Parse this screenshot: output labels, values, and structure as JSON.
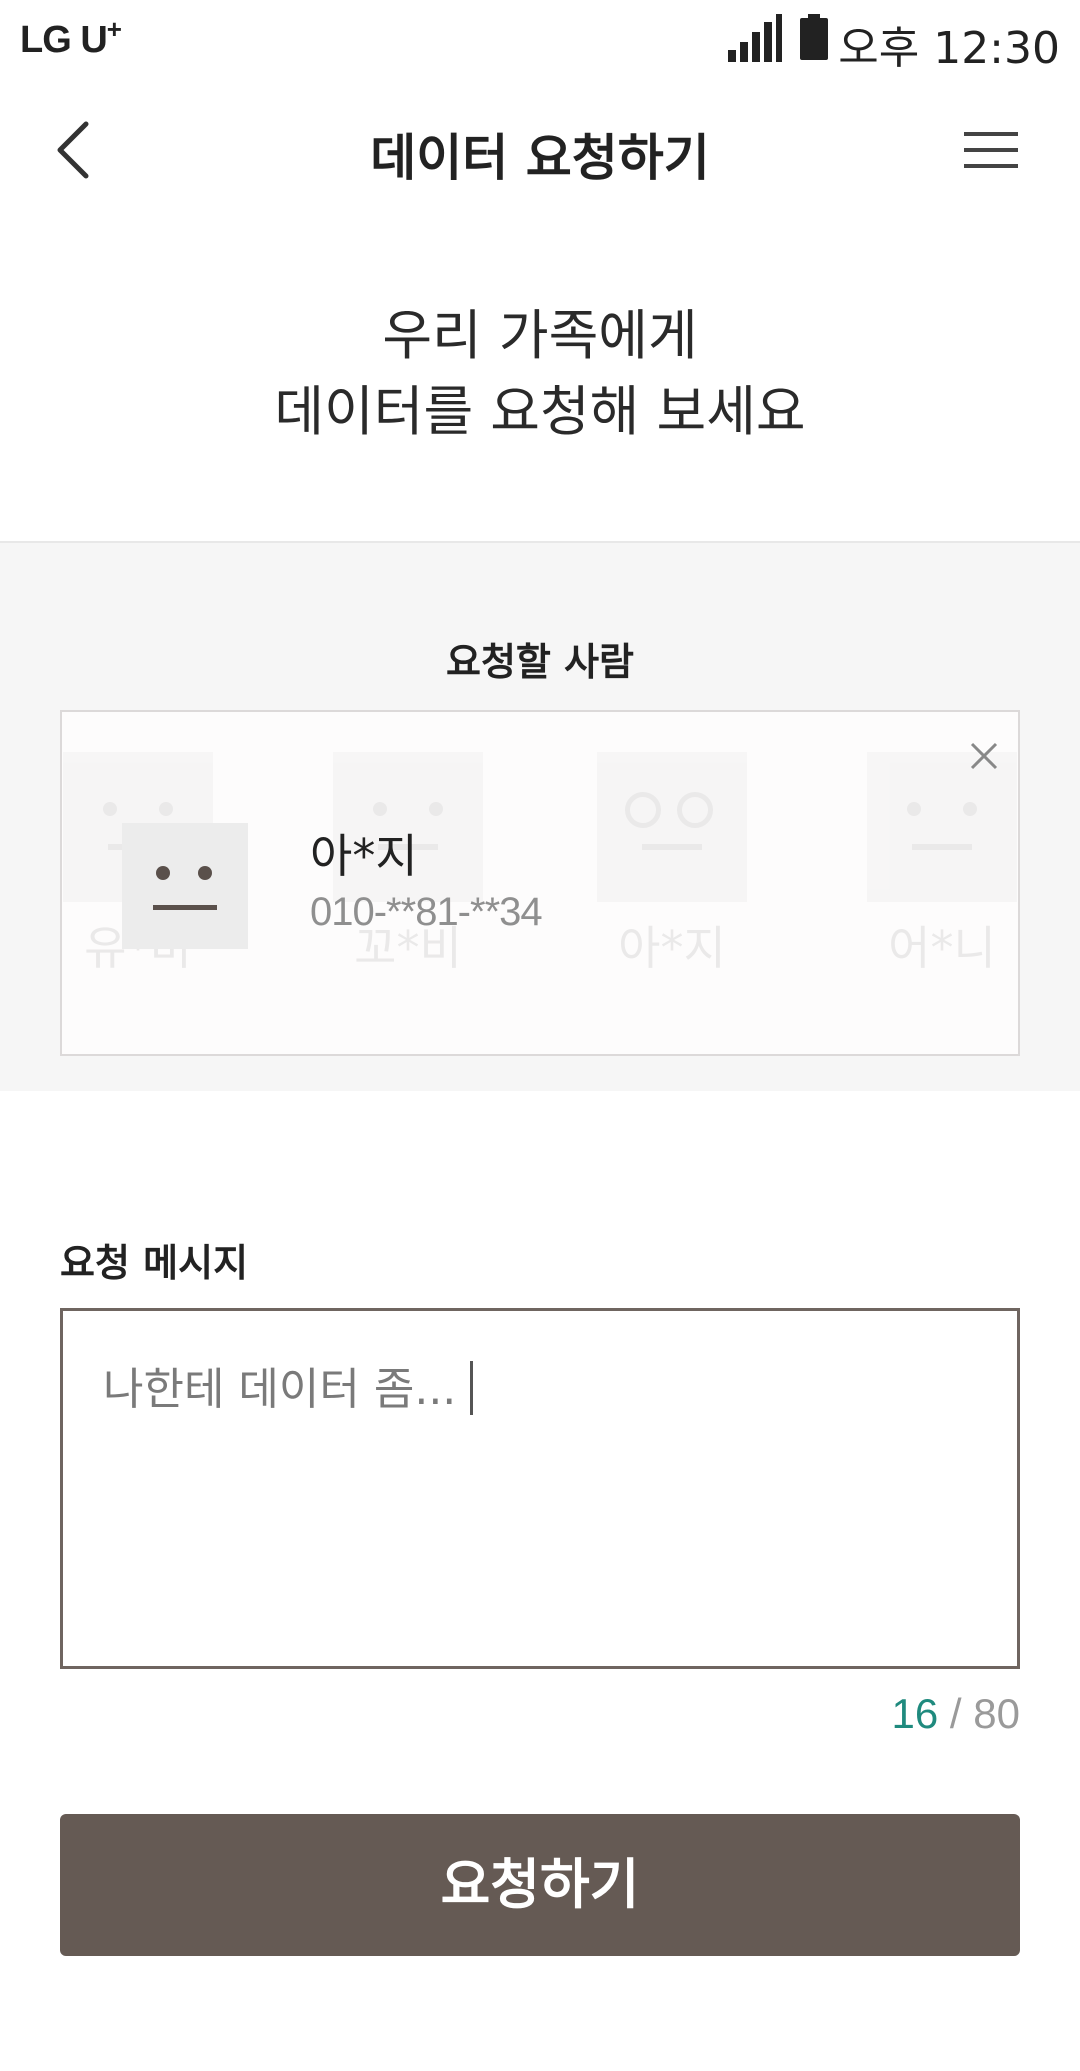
{
  "status_bar": {
    "carrier": "LG U",
    "carrier_plus": "+",
    "time": "오후 12:30",
    "icons": [
      "signal-icon",
      "battery-icon"
    ]
  },
  "app_bar": {
    "title": "데이터 요청하기",
    "back_icon": "chevron-left-icon",
    "menu_icon": "hamburger-menu-icon"
  },
  "headline": {
    "line1": "우리 가족에게",
    "line2": "데이터를 요청해 보세요"
  },
  "recipient": {
    "section_title": "요청할 사람",
    "family_members": [
      {
        "name": "유*비"
      },
      {
        "name": "꼬*비"
      },
      {
        "name": "아*지"
      },
      {
        "name": "어*니"
      }
    ],
    "selected": {
      "name": "아*지",
      "phone": "010-**81-**34"
    },
    "close_icon": "close-icon"
  },
  "message": {
    "label": "요청 메시지",
    "value": "나한테 데이터 좀...",
    "current_length": "16",
    "separator": " / ",
    "max_length": "80"
  },
  "submit": {
    "label": "요청하기"
  },
  "colors": {
    "primary_button": "#655a54",
    "counter_accent": "#1f8a7e",
    "section_background": "#f6f6f6"
  }
}
